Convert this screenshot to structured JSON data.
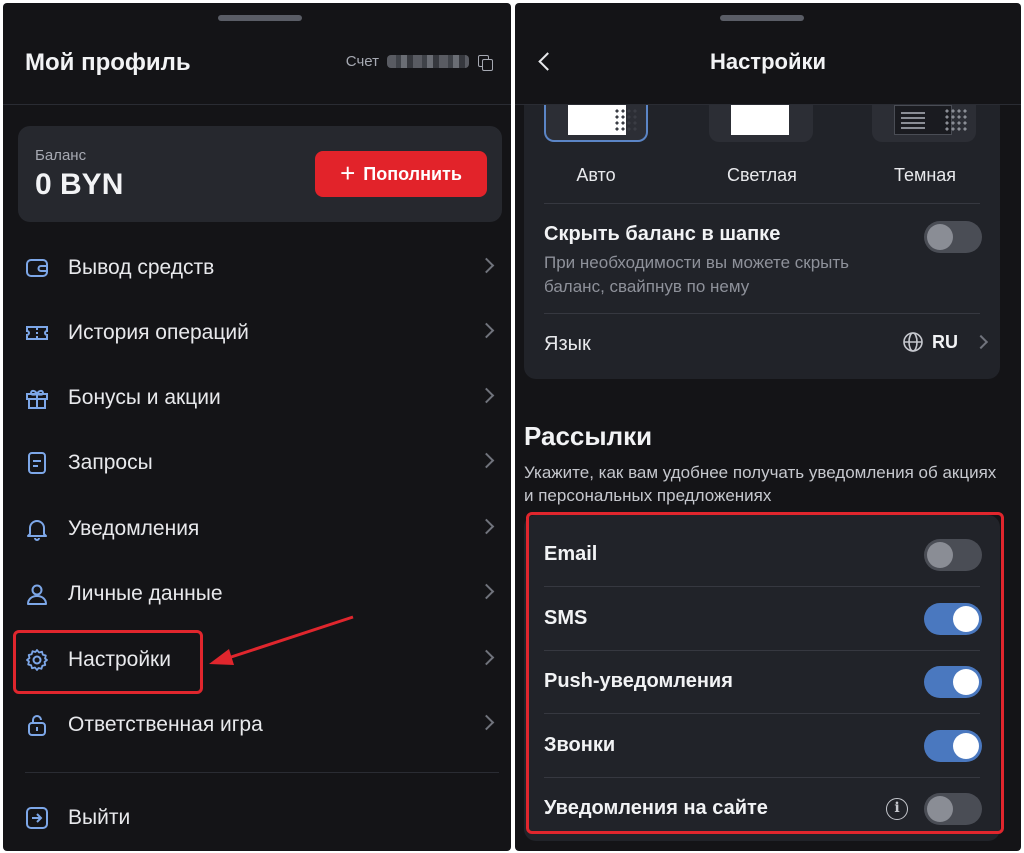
{
  "colors": {
    "background": "#141417",
    "card": "#26282e",
    "accent_red": "#e2232a",
    "toggle_on": "#4a78bf",
    "highlight": "#e0262d"
  },
  "profile": {
    "title": "Мой профиль",
    "account_label": "Счет",
    "copy_icon": "copy-icon",
    "balance_label": "Баланс",
    "balance_value": "0 BYN",
    "topup_label": "Пополнить",
    "menu": [
      {
        "label": "Вывод средств",
        "icon": "wallet-icon"
      },
      {
        "label": "История операций",
        "icon": "ticket-icon"
      },
      {
        "label": "Бонусы и акции",
        "icon": "gift-icon"
      },
      {
        "label": "Запросы",
        "icon": "document-icon"
      },
      {
        "label": "Уведомления",
        "icon": "bell-icon"
      },
      {
        "label": "Личные данные",
        "icon": "user-icon"
      },
      {
        "label": "Настройки",
        "icon": "gear-icon"
      },
      {
        "label": "Ответственная игра",
        "icon": "lock-icon"
      }
    ],
    "logout_label": "Выйти"
  },
  "settings": {
    "title": "Настройки",
    "themes": [
      {
        "label": "Авто",
        "selected": true
      },
      {
        "label": "Светлая",
        "selected": false
      },
      {
        "label": "Темная",
        "selected": false
      }
    ],
    "hide_balance": {
      "title": "Скрыть баланс в шапке",
      "description": "При необходимости вы можете скрыть баланс, свайпнув по нему",
      "enabled": false
    },
    "language": {
      "label": "Язык",
      "value": "RU"
    },
    "mailings": {
      "title": "Рассылки",
      "description": "Укажите, как вам удобнее получать уведомления об акциях и персональных предложениях",
      "items": [
        {
          "label": "Email",
          "enabled": false
        },
        {
          "label": "SMS",
          "enabled": true
        },
        {
          "label": "Push-уведомления",
          "enabled": true
        },
        {
          "label": "Звонки",
          "enabled": true
        },
        {
          "label": "Уведомления на сайте",
          "enabled": false,
          "info": true
        }
      ]
    }
  }
}
